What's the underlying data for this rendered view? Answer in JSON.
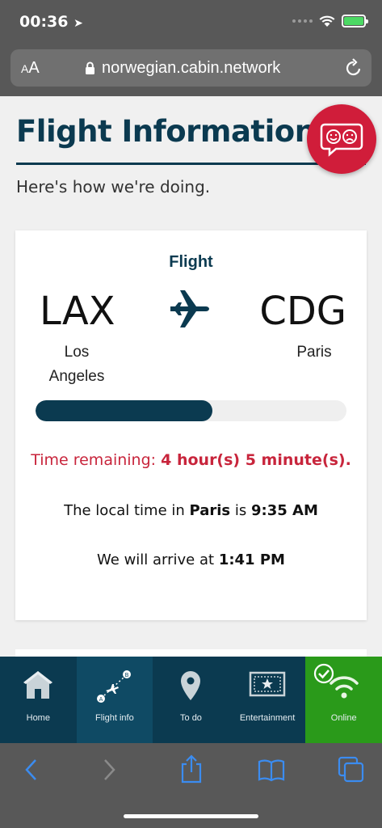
{
  "status": {
    "time": "00:36"
  },
  "browser": {
    "aa_small": "A",
    "aa_big": "A",
    "url": "norwegian.cabin.network"
  },
  "page": {
    "title": "Flight Information",
    "subtitle": "Here's how we're doing.",
    "flight": {
      "label": "Flight",
      "origin_code": "LAX",
      "origin_city": "Los Angeles",
      "destination_code": "CDG",
      "destination_city": "Paris",
      "progress_fraction": 0.57,
      "remaining_prefix": "Time remaining:",
      "remaining_value": "4 hour(s) 5 minute(s).",
      "localtime_prefix": "The local time in",
      "localtime_city": "Paris",
      "localtime_mid": "is",
      "localtime_value": "9:35 AM",
      "arrive_prefix": "We will arrive at",
      "arrive_value": "1:41 PM"
    }
  },
  "nav": {
    "items": [
      {
        "label": "Home",
        "icon": "home-icon"
      },
      {
        "label": "Flight info",
        "icon": "flight-path-icon"
      },
      {
        "label": "To do",
        "icon": "location-pin-icon"
      },
      {
        "label": "Entertainment",
        "icon": "ticket-icon"
      },
      {
        "label": "Online",
        "icon": "wifi-icon"
      }
    ]
  },
  "colors": {
    "brand": "#0b3a50",
    "accent": "#d01d3a",
    "remaining": "#c8253c",
    "online": "#2a9a1a",
    "ios_blue": "#3b8cf0"
  }
}
